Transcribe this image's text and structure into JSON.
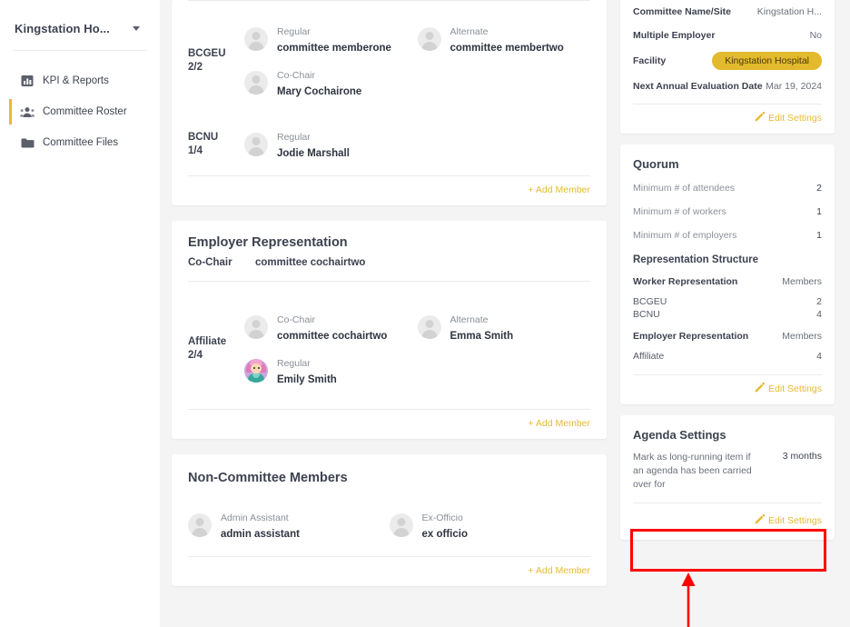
{
  "sidebar": {
    "org_name": "Kingstation Ho...",
    "caret_icon": "chevron-down-icon",
    "items": [
      {
        "label": "KPI & Reports",
        "icon": "bar-chart-icon",
        "active": false
      },
      {
        "label": "Committee Roster",
        "icon": "people-icon",
        "active": true
      },
      {
        "label": "Committee Files",
        "icon": "folder-icon",
        "active": false
      }
    ]
  },
  "worker_card": {
    "groups": [
      {
        "tag_name": "BCGEU",
        "tag_count": "2/2",
        "rows": [
          [
            {
              "role": "Regular",
              "name": "committee memberone",
              "avatar": "placeholder"
            },
            {
              "role": "Alternate",
              "name": "committee membertwo",
              "avatar": "placeholder"
            }
          ],
          [
            {
              "role": "Co-Chair",
              "name": "Mary Cochairone",
              "avatar": "placeholder"
            }
          ]
        ]
      },
      {
        "tag_name": "BCNU",
        "tag_count": "1/4",
        "rows": [
          [
            {
              "role": "Regular",
              "name": "Jodie Marshall",
              "avatar": "placeholder"
            }
          ]
        ]
      }
    ],
    "add_member_label": "+ Add Member"
  },
  "employer_card": {
    "title": "Employer Representation",
    "cochair_label": "Co-Chair",
    "cochair_name": "committee cochairtwo",
    "groups": [
      {
        "tag_name": "Affiliate",
        "tag_count": "2/4",
        "rows": [
          [
            {
              "role": "Co-Chair",
              "name": "committee cochairtwo",
              "avatar": "placeholder"
            },
            {
              "role": "Alternate",
              "name": "Emma Smith",
              "avatar": "placeholder"
            }
          ],
          [
            {
              "role": "Regular",
              "name": "Emily Smith",
              "avatar": "photo"
            }
          ]
        ]
      }
    ],
    "add_member_label": "+ Add Member"
  },
  "noncommittee_card": {
    "title": "Non-Committee Members",
    "members": [
      {
        "role": "Admin Assistant",
        "name": "admin assistant",
        "avatar": "placeholder"
      },
      {
        "role": "Ex-Officio",
        "name": "ex officio",
        "avatar": "placeholder"
      }
    ],
    "add_member_label": "+ Add Member"
  },
  "settings_card": {
    "rows": [
      {
        "label": "Committee Name/Site",
        "value": "Kingstation H..."
      },
      {
        "label": "Multiple Employer",
        "value": "No"
      },
      {
        "label": "Next Annual Evaluation Date",
        "value": "Mar 19, 2024"
      }
    ],
    "facility_label": "Facility",
    "facility_value": "Kingstation Hospital",
    "edit_label": "Edit Settings",
    "edit_icon": "pencil-icon"
  },
  "quorum_card": {
    "title": "Quorum",
    "rows": [
      {
        "label": "Minimum # of attendees",
        "value": "2"
      },
      {
        "label": "Minimum # of workers",
        "value": "1"
      },
      {
        "label": "Minimum # of employers",
        "value": "1"
      }
    ],
    "structure_title": "Representation Structure",
    "worker_heading": "Worker Representation",
    "worker_members_label": "Members",
    "worker_rows": [
      {
        "label": "BCGEU",
        "value": "2"
      },
      {
        "label": "BCNU",
        "value": "4"
      }
    ],
    "employer_heading": "Employer Representation",
    "employer_members_label": "Members",
    "employer_rows": [
      {
        "label": "Affiliate",
        "value": "4"
      }
    ],
    "edit_label": "Edit Settings",
    "edit_icon": "pencil-icon"
  },
  "agenda_card": {
    "title": "Agenda Settings",
    "label": "Mark as long-running item if an agenda has been carried over for",
    "value": "3 months",
    "edit_label": "Edit Settings",
    "edit_icon": "pencil-icon"
  },
  "annotation": {
    "highlight_color": "#ff0000",
    "arrow_icon": "up-arrow-annotation"
  },
  "colors": {
    "accent_gold": "#e8b931",
    "badge_gold": "#e3b92e",
    "text_dark": "#3d4250",
    "text_muted": "#8a8f99",
    "page_bg": "#f4f4f4"
  }
}
